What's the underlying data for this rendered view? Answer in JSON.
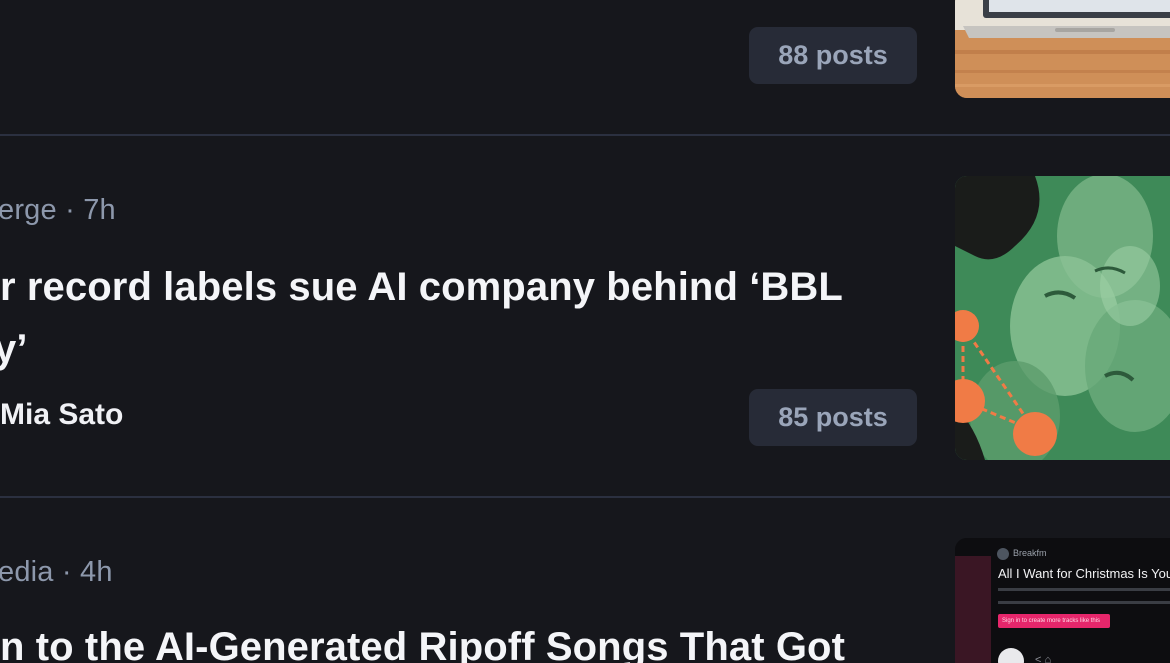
{
  "articles": [
    {
      "posts": "88 posts",
      "thumbnail_icon": "laptop-photo"
    },
    {
      "meta": "erge · 7h",
      "headline_line1": "r record labels sue AI company behind ‘BBL",
      "headline_line2": "y’",
      "byline": "Mia Sato",
      "posts": "85 posts",
      "thumbnail_icon": "ai-music-illustration"
    },
    {
      "meta": "edia · 4h",
      "headline_line1": "n to the AI-Generated Ripoff Songs That Got",
      "thumbnail": {
        "source": "Breakfm",
        "title": "All I Want for Christmas Is You",
        "button": "Sign in to create more tracks like this"
      }
    }
  ],
  "colors": {
    "background": "#16171c",
    "divider": "#2b3040",
    "badge_bg": "#272b37",
    "badge_text": "#9aa5b9",
    "meta_text": "#8d98ac",
    "headline": "#f4f5f8"
  }
}
